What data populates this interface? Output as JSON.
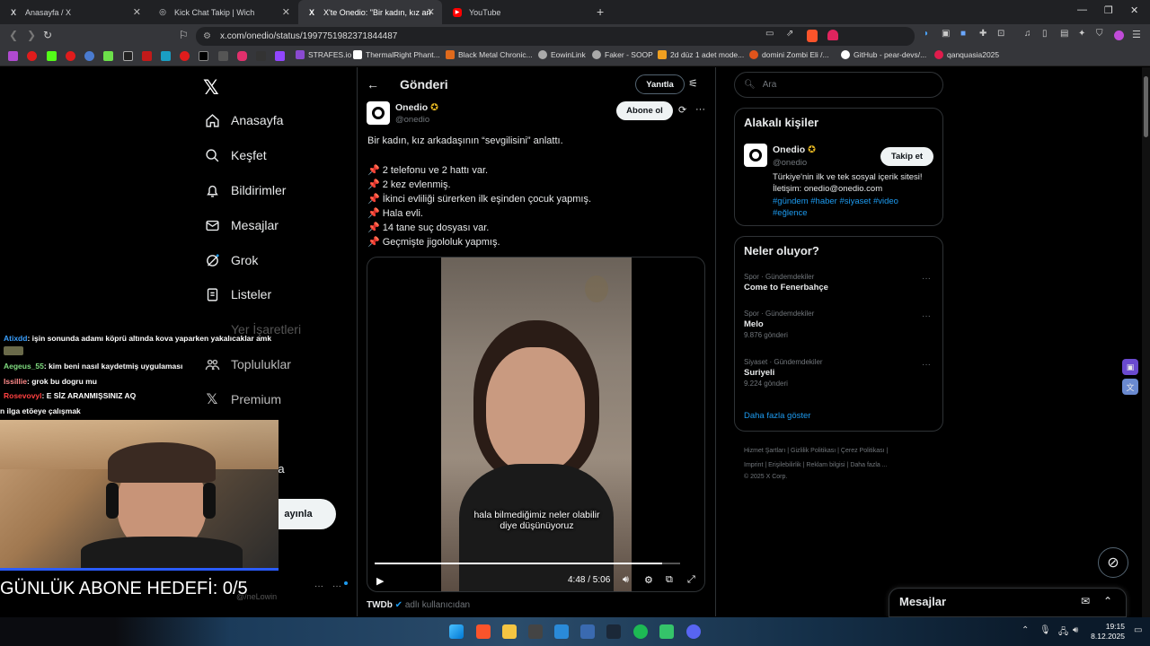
{
  "browser": {
    "tabs": [
      {
        "label": "Anasayfa / X",
        "icon": "X"
      },
      {
        "label": "Kick Chat Takip | Wich",
        "icon": "globe-icon"
      },
      {
        "label": "X'te Onedio: \"Bir kadın, kız arkad",
        "icon": "X"
      },
      {
        "label": "YouTube",
        "icon": "youtube-icon"
      }
    ],
    "url": "x.com/onedio/status/1997751982371844487",
    "bookmarks": [
      "STRAFES.io",
      "ThermalRight Phant...",
      "Black Metal Chronic...",
      "EowinLink",
      "Faker - SOOP",
      "2d düz 1 adet mode...",
      "domini Zombi Eli /...",
      "GitHub - pear-devs/...",
      "qanquasia2025"
    ]
  },
  "nav": {
    "items": [
      "Anasayfa",
      "Keşfet",
      "Bildirimler",
      "Mesajlar",
      "Grok",
      "Listeler",
      "Yer İşaretleri",
      "Topluluklar",
      "Premium"
    ],
    "partial_more": "zla",
    "post_button": "ayınla",
    "partial_handle": "@/neLowin"
  },
  "post": {
    "header_title": "Gönderi",
    "reply_button": "Yanıtla",
    "author_name": "Onedio",
    "author_handle": "@onedio",
    "follow_button": "Abone ol",
    "lines": [
      "Bir kadın, kız arkadaşının “sevgilisini” anlattı.",
      "2 telefonu ve 2 hattı var.",
      "2 kez evlenmiş.",
      "İkinci evliliği sürerken ilk eşinden çocuk yapmış.",
      "Hala evli.",
      "14 tane suç dosyası var.",
      "Geçmişte jigololuk yapmış."
    ],
    "video_caption_1": "hala bilmediğimiz neler olabilir",
    "video_caption_2": "diye düşünüyoruz",
    "video_time": "4:48 / 5:06",
    "video_progress": 0.94,
    "reply_author": "TWDb",
    "reply_text": "adlı kullanıcıdan"
  },
  "right": {
    "search_placeholder": "Ara",
    "related_title": "Alakalı kişiler",
    "related_name": "Onedio",
    "related_handle": "@onedio",
    "related_follow": "Takip et",
    "related_bio": "Türkiye'nin ilk ve tek sosyal içerik sitesi! İletişim: onedio@onedio.com",
    "related_tags": "#gündem #haber #siyaset #video #eğlence",
    "trends_title": "Neler oluyor?",
    "trends": [
      {
        "category": "Spor · Gündemdekiler",
        "name": "Come to Fenerbahçe",
        "count": ""
      },
      {
        "category": "Spor · Gündemdekiler",
        "name": "Melo",
        "count": "9.876 gönderi"
      },
      {
        "category": "Siyaset · Gündemdekiler",
        "name": "Suriyeli",
        "count": "9.224 gönderi"
      }
    ],
    "show_more": "Daha fazla göster",
    "footer": [
      "Hizmet Şartları",
      "Gizlilik Politikası",
      "Çerez Politikası",
      "Imprint",
      "Erişilebilirlik",
      "Reklam bilgisi",
      "Daha fazla ...",
      "© 2025 X Corp."
    ],
    "messages_title": "Mesajlar"
  },
  "overlay": {
    "chat": [
      {
        "user": "Atixdd",
        "text": ": işin sonunda adamı köprü altında kova yaparken yakalıcaklar amk",
        "color": "#3aa0ff"
      },
      {
        "user": "Aegeus_55",
        "text": ": kim beni nasıl kaydetmiş uygulaması",
        "color": "#7fdc7f"
      },
      {
        "user": "Issillie",
        "text": ": grok bu dogru mu",
        "color": "#ff8a8a"
      },
      {
        "user": "Rosevovyl",
        "text": ": E SİZ ARANMIŞSINIZ AQ",
        "color": "#ff4040"
      },
      {
        "user": "",
        "text": "n ilga etöeye çalışmak",
        "color": "#ffffff"
      }
    ],
    "goal_text": "GÜNLÜK ABONE HEDEFİ: 0/5"
  },
  "taskbar": {
    "time": "19:15",
    "date": "8.12.2025"
  }
}
